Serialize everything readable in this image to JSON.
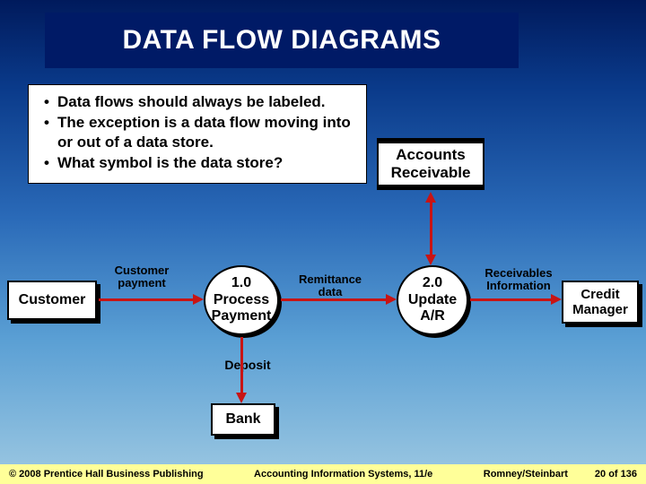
{
  "title": "DATA FLOW DIAGRAMS",
  "bullets": [
    "Data flows should always be labeled.",
    "The exception is a data flow moving into or out of a data store.",
    "What symbol is the data store?"
  ],
  "diagram": {
    "datastore": {
      "label": "Accounts Receivable"
    },
    "entities": {
      "customer": "Customer",
      "credit_manager": "Credit Manager",
      "bank": "Bank"
    },
    "processes": {
      "p1": {
        "num": "1.0",
        "label": "Process Payment"
      },
      "p2": {
        "num": "2.0",
        "label": "Update A/R"
      }
    },
    "flows": {
      "customer_payment": "Customer payment",
      "remittance_data": "Remittance data",
      "receivables_info": "Receivables Information",
      "deposit": "Deposit"
    }
  },
  "footer": {
    "copyright": "© 2008 Prentice Hall Business Publishing",
    "book": "Accounting Information Systems, 11/e",
    "authors": "Romney/Steinbart",
    "page": "20 of 136"
  }
}
